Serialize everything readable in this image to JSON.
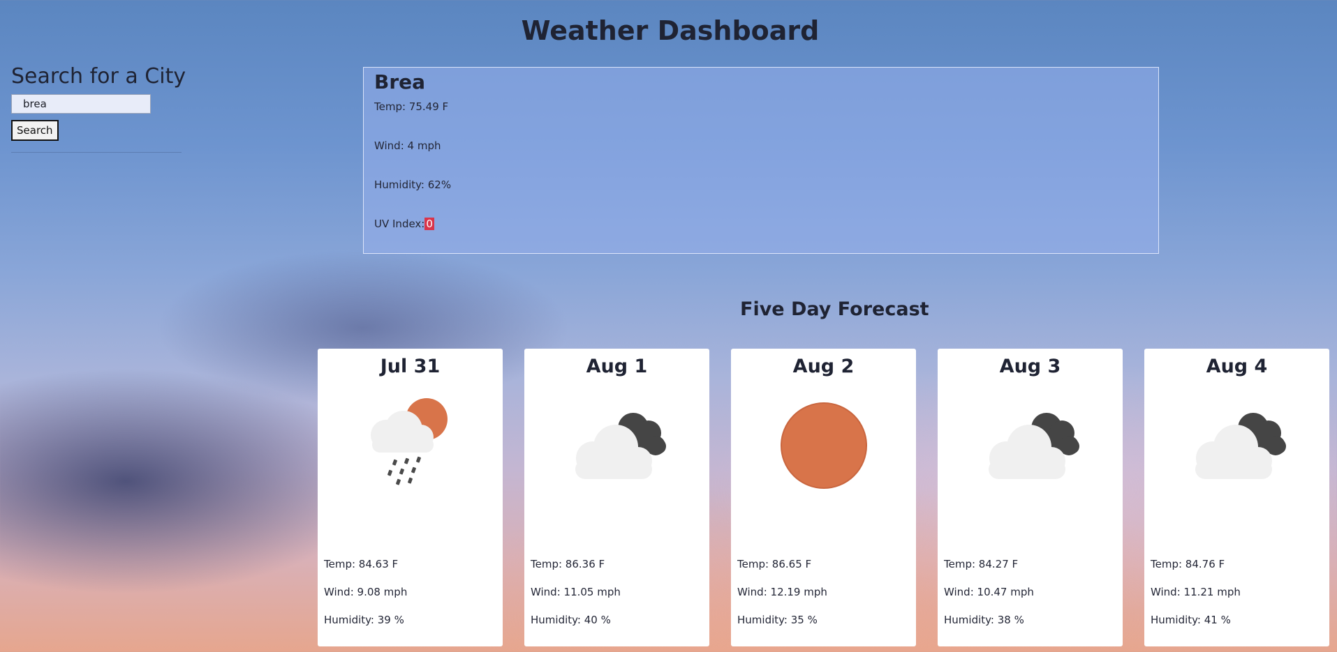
{
  "header": {
    "title": "Weather Dashboard"
  },
  "search": {
    "heading": "Search for a City",
    "input_value": "brea",
    "button_label": "Search"
  },
  "current": {
    "city": "Brea",
    "temp": "Temp: 75.49 F",
    "wind": "Wind: 4 mph",
    "humidity": "Humidity: 62%",
    "uv_label": "UV Index:",
    "uv_value": "0",
    "uv_color": "#d9354b"
  },
  "forecast": {
    "heading": "Five Day Forecast",
    "days": [
      {
        "date": "Jul 31",
        "icon": "rain-cloud-sun-icon",
        "temp": "Temp: 84.63 F",
        "wind": "Wind: 9.08 mph",
        "humidity": "Humidity: 39 %"
      },
      {
        "date": "Aug 1",
        "icon": "broken-clouds-icon",
        "temp": "Temp: 86.36 F",
        "wind": "Wind: 11.05 mph",
        "humidity": "Humidity: 40 %"
      },
      {
        "date": "Aug 2",
        "icon": "clear-sun-icon",
        "temp": "Temp: 86.65 F",
        "wind": "Wind: 12.19 mph",
        "humidity": "Humidity: 35 %"
      },
      {
        "date": "Aug 3",
        "icon": "broken-clouds-icon",
        "temp": "Temp: 84.27 F",
        "wind": "Wind: 10.47 mph",
        "humidity": "Humidity: 38 %"
      },
      {
        "date": "Aug 4",
        "icon": "broken-clouds-icon",
        "temp": "Temp: 84.76 F",
        "wind": "Wind: 11.21 mph",
        "humidity": "Humidity: 41 %"
      }
    ]
  },
  "colors": {
    "sun": "#d8744a",
    "dark_cloud": "#454545",
    "light_cloud": "#f0f0f0",
    "rain": "#4a4a4a"
  }
}
